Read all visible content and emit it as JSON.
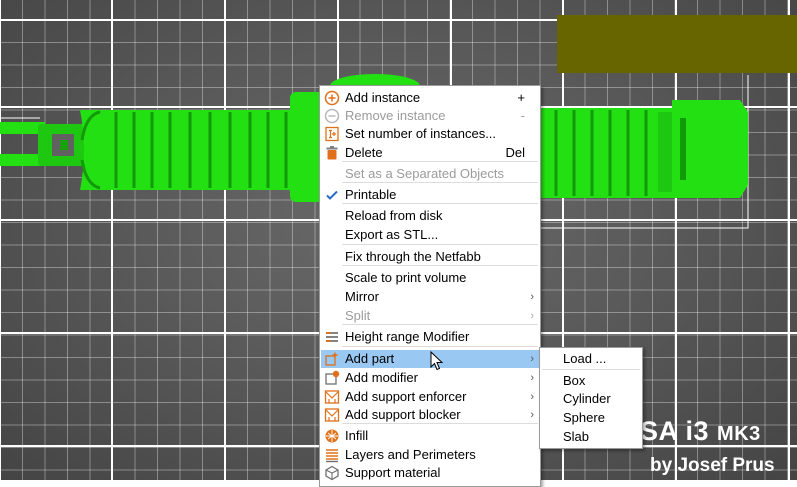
{
  "plate": {
    "line1": "SA i3",
    "line1_model": "MK3",
    "line2": "by Josef Prus"
  },
  "colors": {
    "model": "#22e012",
    "model_dark": "#129a08",
    "grid": "#ffffff",
    "background": "#5a5a5a",
    "highlight": "#99c8f2",
    "olive_overlay": "#676500"
  },
  "context_menu": {
    "items": [
      {
        "label": "Add instance",
        "shortcut": "+",
        "icon": "plus-circle-icon",
        "enabled": true
      },
      {
        "label": "Remove instance",
        "shortcut": "-",
        "icon": "minus-circle-icon",
        "enabled": false
      },
      {
        "label": "Set number of instances...",
        "icon": "instances-icon",
        "enabled": true
      },
      {
        "label": "Delete",
        "shortcut": "Del",
        "icon": "trash-icon",
        "enabled": true
      },
      {
        "label": "Set as a Separated Objects",
        "enabled": false
      },
      {
        "label": "Printable",
        "icon": "check-icon",
        "enabled": true,
        "checked": true
      },
      {
        "label": "Reload from disk",
        "enabled": true
      },
      {
        "label": "Export as STL...",
        "enabled": true
      },
      {
        "label": "Fix through the Netfabb",
        "enabled": true
      },
      {
        "label": "Scale to print volume",
        "enabled": true
      },
      {
        "label": "Mirror",
        "enabled": true,
        "submenu": true
      },
      {
        "label": "Split",
        "enabled": false,
        "submenu": true
      },
      {
        "label": "Height range Modifier",
        "icon": "height-range-icon",
        "enabled": true
      },
      {
        "label": "Add part",
        "icon": "add-part-icon",
        "enabled": true,
        "submenu": true,
        "highlighted": true
      },
      {
        "label": "Add modifier",
        "icon": "add-modifier-icon",
        "enabled": true,
        "submenu": true
      },
      {
        "label": "Add support enforcer",
        "icon": "support-enforcer-icon",
        "enabled": true,
        "submenu": true
      },
      {
        "label": "Add support blocker",
        "icon": "support-blocker-icon",
        "enabled": true,
        "submenu": true
      },
      {
        "label": "Infill",
        "icon": "infill-icon",
        "enabled": true
      },
      {
        "label": "Layers and Perimeters",
        "icon": "layers-icon",
        "enabled": true
      },
      {
        "label": "Support material",
        "icon": "support-material-icon",
        "enabled": true
      }
    ]
  },
  "submenu": {
    "items": [
      {
        "label": "Load ..."
      },
      {
        "label": "Box"
      },
      {
        "label": "Cylinder"
      },
      {
        "label": "Sphere"
      },
      {
        "label": "Slab"
      }
    ]
  }
}
